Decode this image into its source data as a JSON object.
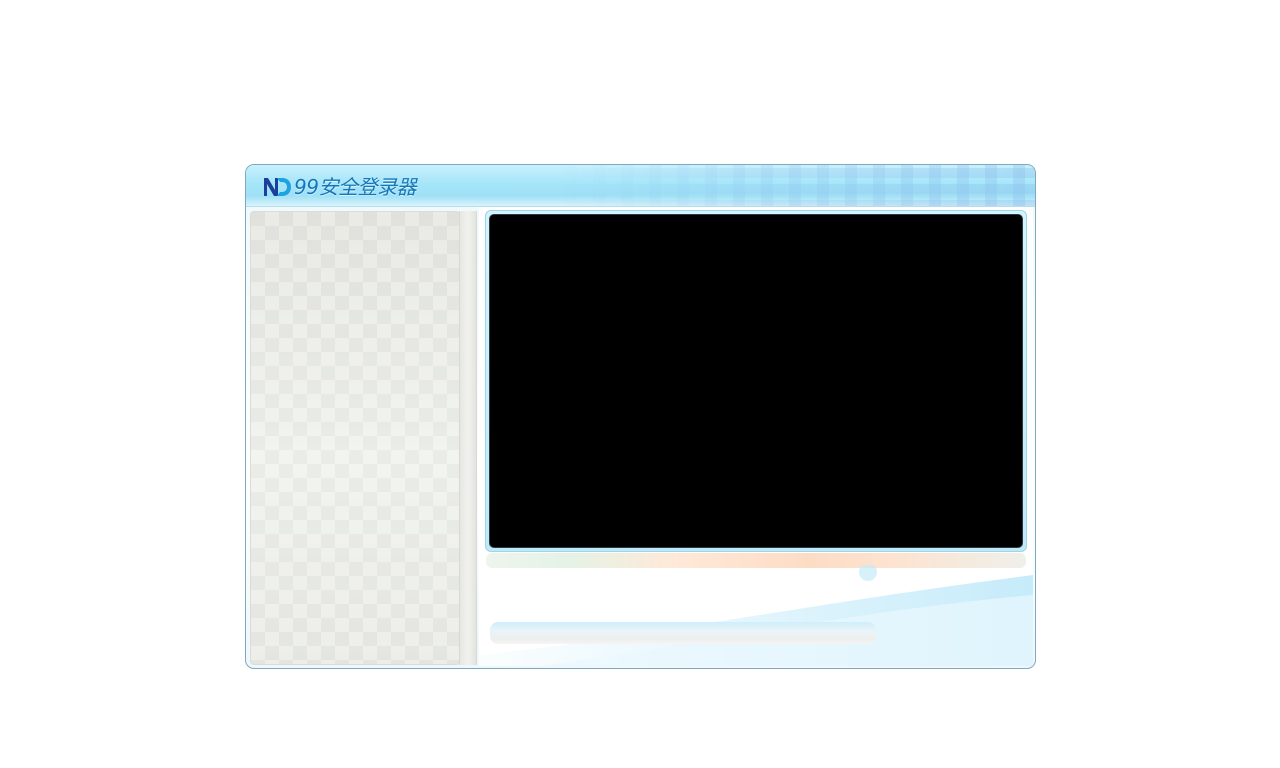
{
  "window": {
    "title": "99安全登录器",
    "logo_text": "ND"
  },
  "colors": {
    "title_text": "#1577b8",
    "titlebar": "#a6e6fa",
    "video_background": "#000000",
    "left_panel": "#e9eae5"
  },
  "icons": {
    "logo": "nd-logo-icon"
  }
}
